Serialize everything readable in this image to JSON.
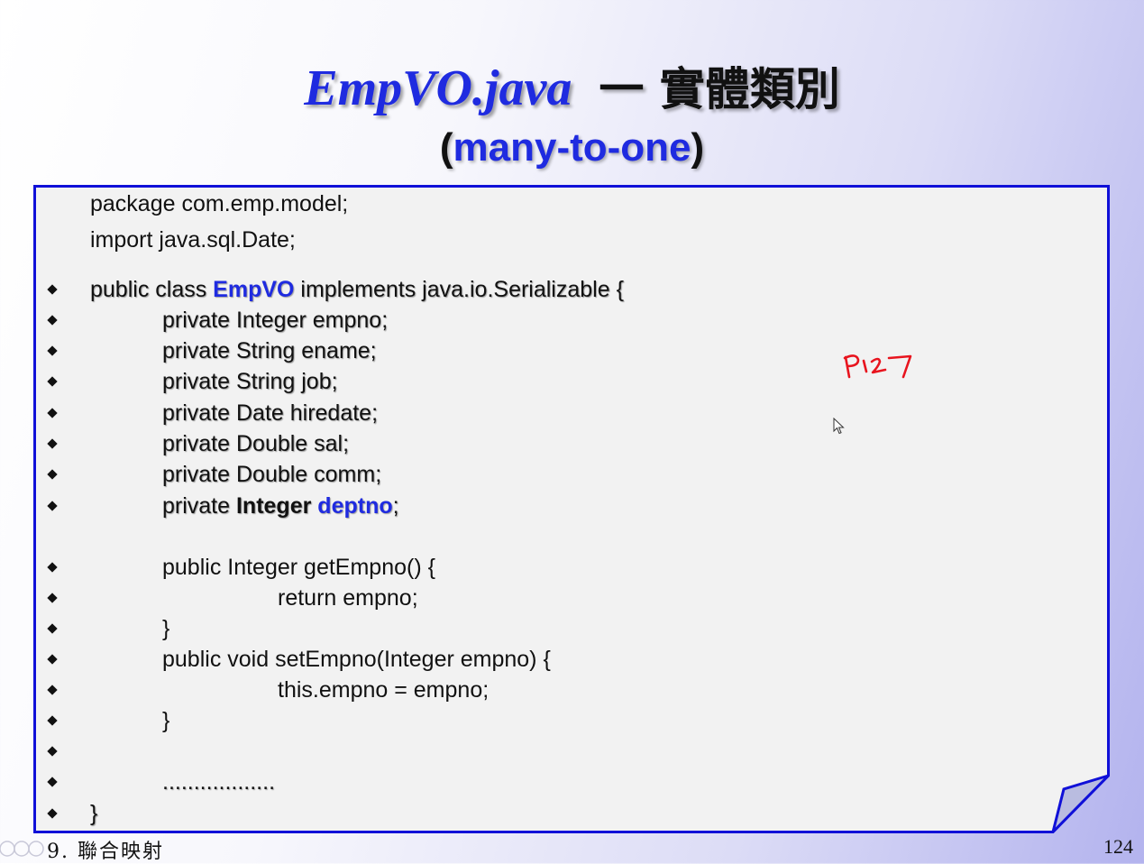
{
  "title": {
    "file": "EmpVO.java",
    "rest": "一 實體類別",
    "sub_open": "(",
    "sub_em": "many-to-one",
    "sub_close": ")"
  },
  "code": {
    "package_line": "package com.emp.model;",
    "import_line": "import java.sql.Date;",
    "class_decl": {
      "before": "public class ",
      "name": "EmpVO",
      "after": " implements java.io.Serializable {"
    },
    "fields": [
      "private Integer empno;",
      "private String ename;",
      "private String job;",
      "private Date hiredate;",
      "private Double sal;",
      "private Double comm;"
    ],
    "deptno_field": {
      "before": "private ",
      "type": "Integer",
      "space": " ",
      "name": "deptno",
      "after": ";"
    },
    "getter_sig": "public Integer getEmpno() {",
    "getter_body": "return empno;",
    "close_brace": "}",
    "setter_sig": "public void setEmpno(Integer empno) {",
    "setter_body": "this.empno = empno;",
    "ellipsis": "..................",
    "final_brace": "}"
  },
  "annotation": {
    "text": "P127",
    "color": "#e8141e"
  },
  "footer": {
    "chapter": "9. 聯合映射",
    "page_number": "124"
  },
  "colors": {
    "accent_blue": "#1f2be0",
    "panel_border": "#1010d8",
    "panel_bg": "#f2f2f2"
  }
}
